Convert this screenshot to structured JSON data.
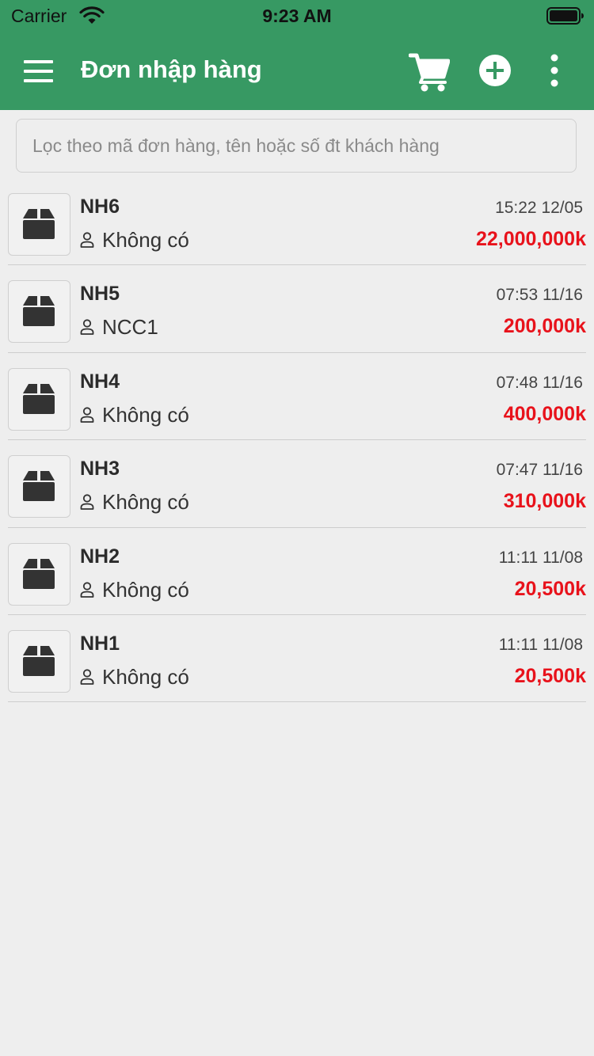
{
  "status_bar": {
    "carrier": "Carrier",
    "time": "9:23 AM",
    "icons": [
      "wifi-icon",
      "battery-icon"
    ]
  },
  "app_bar": {
    "title": "Đơn nhập hàng",
    "icons": [
      "menu-icon",
      "cart-icon",
      "add-icon",
      "more-vertical-icon"
    ]
  },
  "search": {
    "placeholder": "Lọc theo mã đơn hàng, tên hoặc số đt khách hàng",
    "value": ""
  },
  "orders": [
    {
      "code": "NH6",
      "supplier": "Không có",
      "time": "15:22 12/05",
      "amount": "22,000,000k"
    },
    {
      "code": "NH5",
      "supplier": "NCC1",
      "time": "07:53 11/16",
      "amount": "200,000k"
    },
    {
      "code": "NH4",
      "supplier": "Không có",
      "time": "07:48 11/16",
      "amount": "400,000k"
    },
    {
      "code": "NH3",
      "supplier": "Không có",
      "time": "07:47 11/16",
      "amount": "310,000k"
    },
    {
      "code": "NH2",
      "supplier": "Không có",
      "time": "11:11 11/08",
      "amount": "20,500k"
    },
    {
      "code": "NH1",
      "supplier": "Không có",
      "time": "11:11 11/08",
      "amount": "20,500k"
    }
  ],
  "colors": {
    "primary": "#379963",
    "background": "#eeeeee",
    "amount": "#e8121b",
    "text": "#2b2b2b"
  }
}
